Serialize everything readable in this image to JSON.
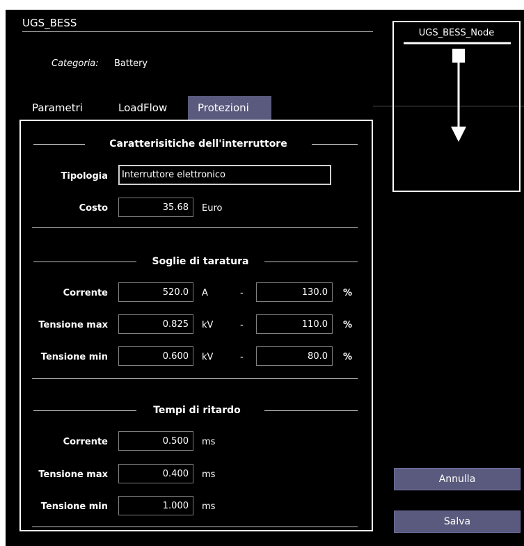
{
  "node": {
    "name": "UGS_BESS",
    "category_label": "Categoria:",
    "category_value": "Battery"
  },
  "tabs": [
    {
      "label": "Parametri",
      "active": false
    },
    {
      "label": "LoadFlow",
      "active": false
    },
    {
      "label": "Protezioni",
      "active": true
    }
  ],
  "breaker": {
    "section_title": "Caratterisitiche dell'interruttore",
    "tipologia_label": "Tipologia",
    "tipologia_value": "Interruttore elettronico",
    "costo_label": "Costo",
    "costo_value": "35.68",
    "costo_unit": "Euro"
  },
  "soglie": {
    "section_title": "Soglie di taratura",
    "rows": [
      {
        "label": "Corrente",
        "value": "520.0",
        "unit": "A",
        "sep": "-",
        "pct_value": "130.0",
        "pct": "%"
      },
      {
        "label": "Tensione max",
        "value": "0.825",
        "unit": "kV",
        "sep": "-",
        "pct_value": "110.0",
        "pct": "%"
      },
      {
        "label": "Tensione min",
        "value": "0.600",
        "unit": "kV",
        "sep": "-",
        "pct_value": "80.0",
        "pct": "%"
      }
    ]
  },
  "tempi": {
    "section_title": "Tempi di ritardo",
    "rows": [
      {
        "label": "Corrente",
        "value": "0.500",
        "unit": "ms"
      },
      {
        "label": "Tensione max",
        "value": "0.400",
        "unit": "ms"
      },
      {
        "label": "Tensione min",
        "value": "1.000",
        "unit": "ms"
      }
    ]
  },
  "diagram": {
    "node_label": "UGS_BESS_Node"
  },
  "buttons": {
    "cancel": "Annulla",
    "save": "Salva"
  },
  "colors": {
    "background": "#000000",
    "accent": "#5a5a7e",
    "text": "#ffffff"
  }
}
